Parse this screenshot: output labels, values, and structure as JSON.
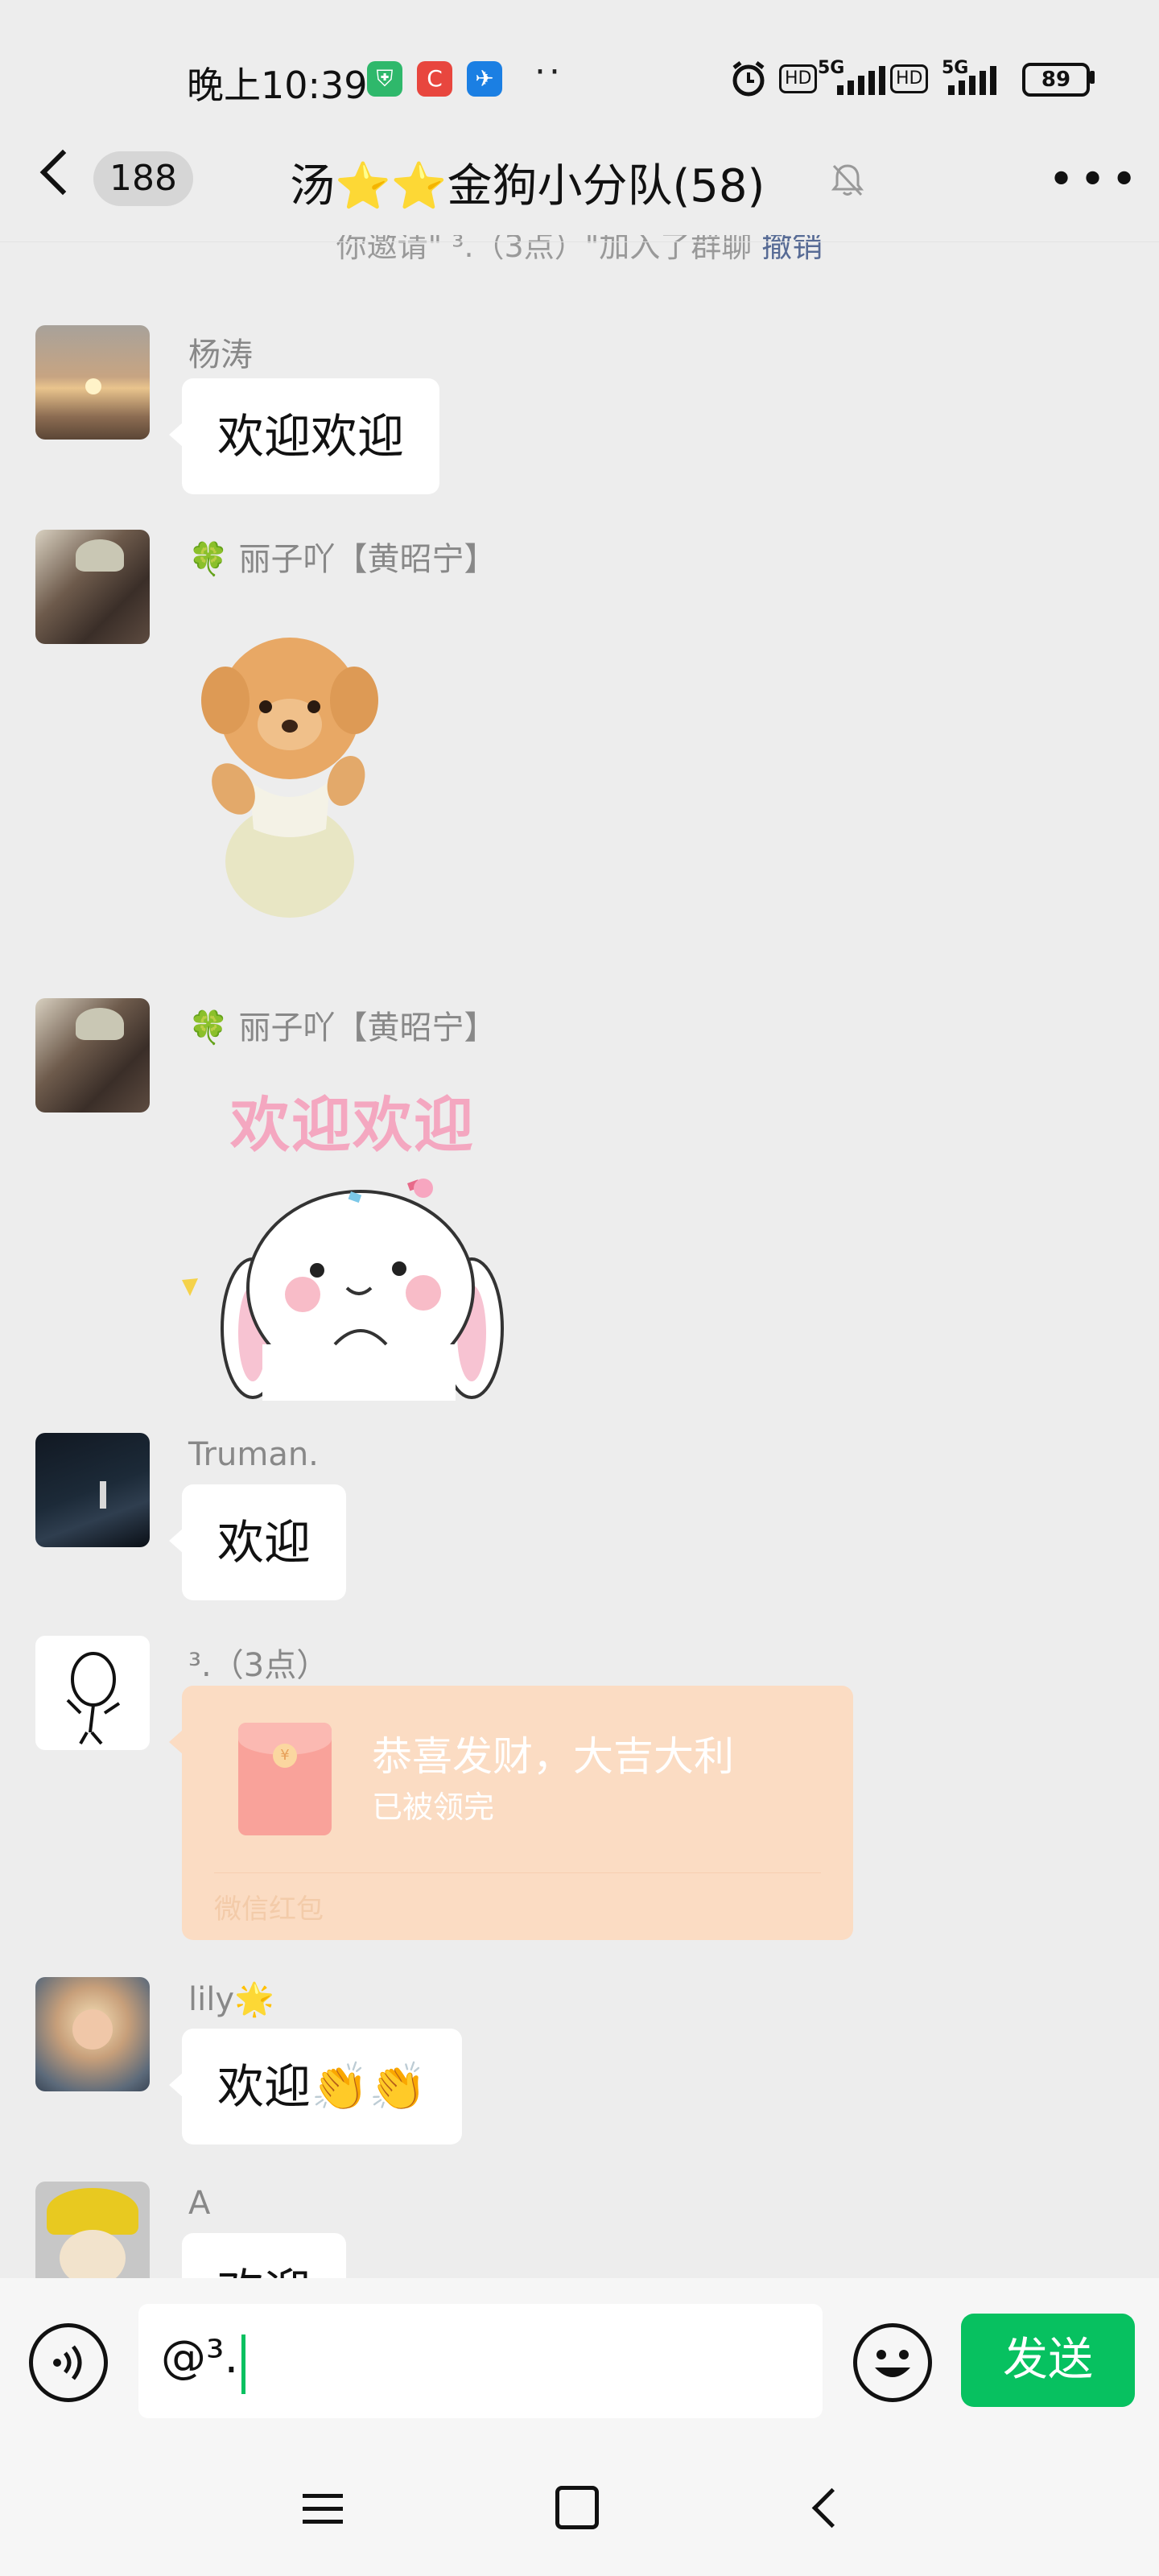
{
  "status_bar": {
    "time": "晚上10:39",
    "network_5g_1": "5G",
    "network_5g_2": "5G",
    "hd_1": "HD",
    "hd_2": "HD",
    "battery": "89",
    "icons": [
      "vpn-shield-icon",
      "app-c-icon",
      "app-bird-icon",
      "more-dots-icon",
      "alarm-icon",
      "signal-icon",
      "battery-icon"
    ]
  },
  "header": {
    "unread_count": "188",
    "title": "汤⭐️⭐️金狗小分队(58)",
    "icons": [
      "back-chevron-icon",
      "mute-bell-icon",
      "more-icon"
    ]
  },
  "system_message": {
    "text": "你邀请\"  ³.（3点）\"加入了群聊",
    "link": "撤销"
  },
  "messages": [
    {
      "sender": "杨涛",
      "type": "text",
      "text": "欢迎欢迎"
    },
    {
      "sender": "🍀 丽子吖【黄昭宁】",
      "type": "sticker",
      "sticker": "plush-dog-sticker"
    },
    {
      "sender": "🍀 丽子吖【黄昭宁】",
      "type": "sticker",
      "sticker": "bunny-welcome-sticker",
      "sticker_text": "欢迎欢迎"
    },
    {
      "sender": "Truman.",
      "type": "text",
      "text": "欢迎"
    },
    {
      "sender": "³.（3点）",
      "type": "red_packet",
      "title": "恭喜发财，大吉大利",
      "status": "已被领完",
      "footer": "微信红包"
    },
    {
      "sender": "lily🌟",
      "type": "text",
      "text": "欢迎👏👏"
    },
    {
      "sender": "A",
      "type": "text",
      "text": "欢迎"
    }
  ],
  "input": {
    "value": "@³.",
    "send_label": "发送"
  },
  "colors": {
    "background": "#ededed",
    "send_green": "#07c160",
    "red_packet": "#fbdcc3",
    "link_blue": "#576b95"
  }
}
